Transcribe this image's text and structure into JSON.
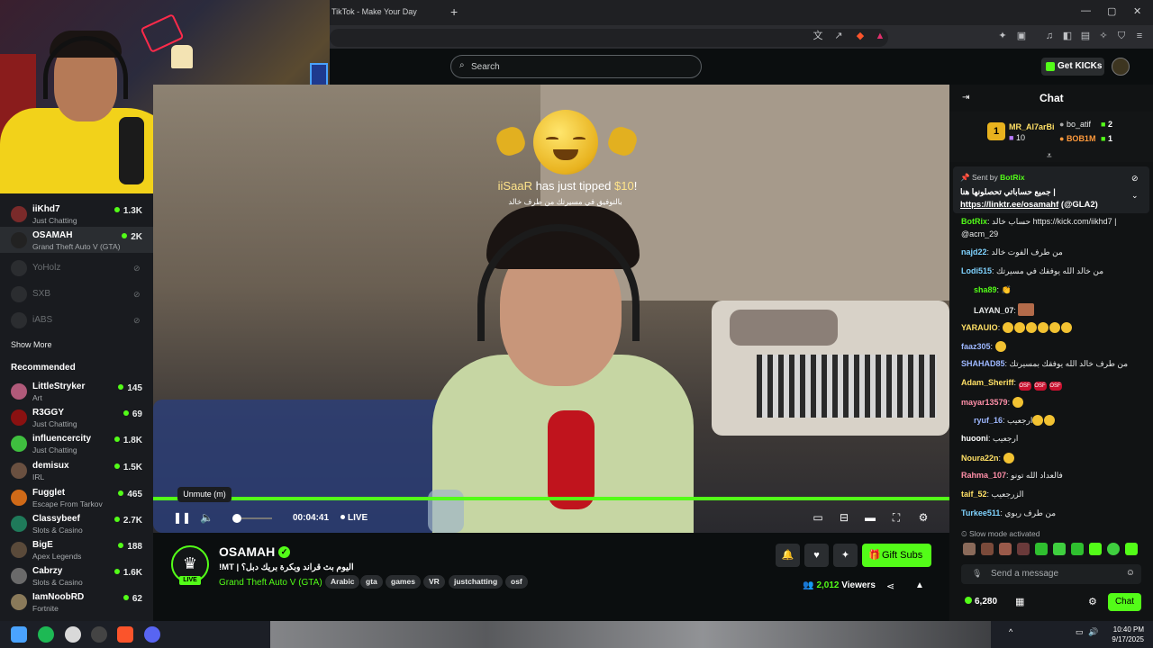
{
  "browser": {
    "tab_title": "TikTok - Make Your Day",
    "new_tab": "+",
    "minimize": "—",
    "maximize": "▢",
    "close": "✕"
  },
  "header": {
    "search_placeholder": "Search",
    "get_kicks_label": "Get KICKs"
  },
  "sidebar": {
    "following": [
      {
        "name": "iiKhd7",
        "category": "Just Chatting",
        "viewers": "1.3K",
        "live": true
      },
      {
        "name": "OSAMAH",
        "category": "Grand Theft Auto V (GTA)",
        "viewers": "2K",
        "live": true,
        "active": true
      },
      {
        "name": "YoHolz",
        "live": false
      },
      {
        "name": "SXB",
        "live": false
      },
      {
        "name": "iABS",
        "live": false
      }
    ],
    "show_more": "Show More",
    "recommended_heading": "Recommended",
    "recommended": [
      {
        "name": "LittleStryker",
        "category": "Art",
        "viewers": "145"
      },
      {
        "name": "R3GGY",
        "category": "Just Chatting",
        "viewers": "69"
      },
      {
        "name": "influencercity",
        "category": "Just Chatting",
        "viewers": "1.8K"
      },
      {
        "name": "demisux",
        "category": "IRL",
        "viewers": "1.5K"
      },
      {
        "name": "Fugglet",
        "category": "Escape From Tarkov",
        "viewers": "465"
      },
      {
        "name": "Classybeef",
        "category": "Slots & Casino",
        "viewers": "2.7K"
      },
      {
        "name": "BigE",
        "category": "Apex Legends",
        "viewers": "188"
      },
      {
        "name": "Cabrzy",
        "category": "Slots & Casino",
        "viewers": "1.6K"
      },
      {
        "name": "IamNoobRD",
        "category": "Fortnite",
        "viewers": "62"
      }
    ]
  },
  "player": {
    "tip_user": "iiSaaR",
    "tip_text": " has just tipped ",
    "tip_amount": "$10",
    "tip_end": "!",
    "tip_sub": "بالتوفيق في مسيرتك من طرف خالد",
    "tooltip": "Unmute (m)",
    "time": "00:04:41",
    "live_label": "LIVE",
    "progress": 1.0
  },
  "channel": {
    "name": "OSAMAH",
    "live_badge": "LIVE",
    "title": "!MT | اليوم بث قراند وبكرة بريك دبل؟",
    "category": "Grand Theft Auto V (GTA)",
    "tags": [
      "Arabic",
      "gta",
      "games",
      "VR",
      "justchatting",
      "osf"
    ],
    "gift_subs_label": "Gift Subs",
    "viewers_count": "2,012",
    "viewers_label": "Viewers"
  },
  "chat": {
    "title": "Chat",
    "leaderboard": {
      "first": {
        "name": "MR_Al7arBi",
        "count": "10",
        "rank": "1"
      },
      "second": {
        "name": "bo_atif",
        "count": "2"
      },
      "third": {
        "name": "BOB1M",
        "count": "1"
      }
    },
    "pinned": {
      "sent_by_label": "Sent by",
      "sender": "BotRix",
      "line1": "جميع حساباتي تحصلونها هنا |",
      "link": "https://linktr.ee/osamahf",
      "handle": "(@GLA2)"
    },
    "messages": [
      {
        "user": "BotRix",
        "color": "#53fc18",
        "text": "حساب خالد https://kick.com/iikhd7 |"
      },
      {
        "user": "",
        "color": "#e8eaea",
        "text": "@acm_29"
      },
      {
        "user": "najd22",
        "color": "#7fd3ff",
        "text": "من طرف الفوت خالد"
      },
      {
        "user": "Lodi515",
        "color": "#7fd3ff",
        "text": "من خالد الله يوفقك في مسيرتك"
      },
      {
        "user": "sha89",
        "color": "#53fc18",
        "text": "👏"
      },
      {
        "user": "LAYAN_07",
        "color": "#e8eaea",
        "text": ""
      },
      {
        "user": "YARAUIO",
        "color": "#ffe066",
        "text": ""
      },
      {
        "user": "faaz305",
        "color": "#9db7ff",
        "text": ""
      },
      {
        "user": "SHAHAD85",
        "color": "#9db7ff",
        "text": "من طرف خالد الله يوفقك بمسيرتك"
      },
      {
        "user": "Adam_Sheriff",
        "color": "#ffe066",
        "text": ""
      },
      {
        "user": "mayar13579",
        "color": "#ff8fa8",
        "text": ""
      },
      {
        "user": "ryuf_16",
        "color": "#9db7ff",
        "text": "ارجعيب"
      },
      {
        "user": "huooni",
        "color": "#ffffff",
        "text": "ارجعيب"
      },
      {
        "user": "Noura22n",
        "color": "#ffe066",
        "text": ""
      },
      {
        "user": "Rahma_107",
        "color": "#ff8fa8",
        "text": "فالعداد الله تونو"
      },
      {
        "user": "taif_52",
        "color": "#ffe066",
        "text": "الزرجعيب"
      },
      {
        "user": "Turkee511",
        "color": "#7fd3ff",
        "text": "من طرف ربوي"
      }
    ],
    "slow_mode": "Slow mode activated",
    "send_placeholder": "Send a message",
    "kicks_balance": "6,280",
    "chat_button": "Chat"
  },
  "taskbar": {
    "time": "10:40 PM",
    "date": "9/17/2025"
  }
}
